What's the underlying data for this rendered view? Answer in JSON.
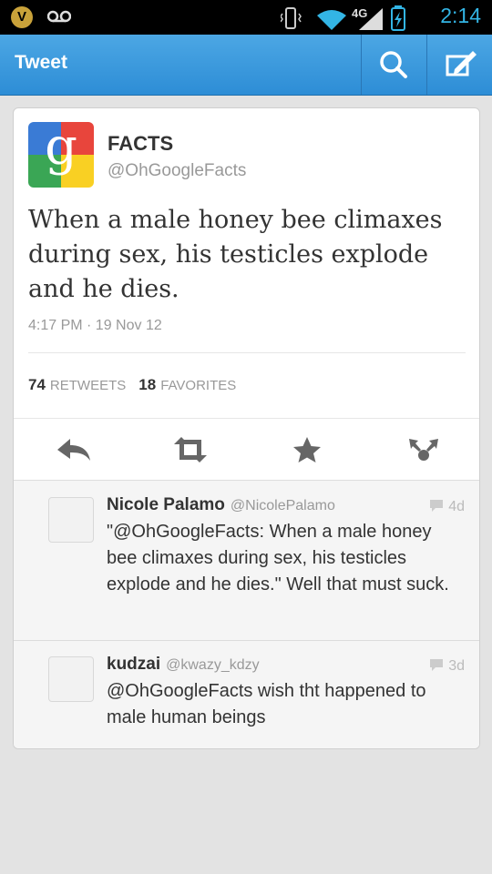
{
  "status_bar": {
    "time": "2:14",
    "carrier_badge": "V",
    "network": "4G"
  },
  "action_bar": {
    "title": "Tweet",
    "search_icon": "search-icon",
    "compose_icon": "compose-icon"
  },
  "tweet": {
    "author_name": "FACTS",
    "author_handle": "@OhGoogleFacts",
    "avatar_letter": "g",
    "text": "When a male honey bee climaxes during sex, his testicles explode and he dies.",
    "timestamp": "4:17 PM · 19 Nov 12",
    "retweets_count": "74",
    "retweets_label": "RETWEETS",
    "favorites_count": "18",
    "favorites_label": "FAVORITES",
    "colors": {
      "avatar_blue": "#3a7bd5",
      "avatar_red": "#e8453c",
      "avatar_green": "#3aa655",
      "avatar_yellow": "#f9d023"
    }
  },
  "actions": [
    {
      "name": "reply-icon"
    },
    {
      "name": "retweet-icon"
    },
    {
      "name": "favorite-icon"
    },
    {
      "name": "share-icon"
    }
  ],
  "replies": [
    {
      "name": "Nicole Palamo",
      "handle": "@NicolePalamo",
      "age": "4d",
      "text": "\"@OhGoogleFacts: When a male honey bee climaxes during sex, his testicles explode and he dies.\" Well that must suck."
    },
    {
      "name": "kudzai",
      "handle": "@kwazy_kdzy",
      "age": "3d",
      "text": "@OhGoogleFacts wish tht happened to male human beings"
    }
  ],
  "accent_color": "#33b5e5"
}
